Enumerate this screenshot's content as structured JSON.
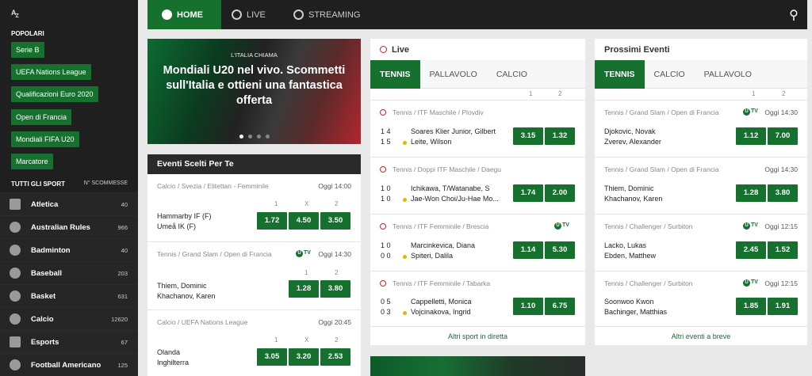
{
  "sidebar": {
    "az_a": "A",
    "az_z": "Z",
    "popular_heading": "POPOLARI",
    "popular": [
      "Serie B",
      "UEFA Nations League",
      "Qualificazioni Euro 2020",
      "Open di Francia",
      "Mondiali FIFA U20",
      "Marcatore"
    ],
    "all_sports": "TUTTI GLI SPORT",
    "num_bets": "N° SCOMMESSE",
    "sports": [
      {
        "name": "Atletica",
        "count": "40",
        "icon": "athletics-icon"
      },
      {
        "name": "Australian Rules",
        "count": "966",
        "icon": "aussie-rules-icon"
      },
      {
        "name": "Badminton",
        "count": "40",
        "icon": "badminton-icon"
      },
      {
        "name": "Baseball",
        "count": "203",
        "icon": "baseball-icon"
      },
      {
        "name": "Basket",
        "count": "631",
        "icon": "basketball-icon"
      },
      {
        "name": "Calcio",
        "count": "12620",
        "icon": "soccer-icon"
      },
      {
        "name": "Esports",
        "count": "67",
        "icon": "gamepad-icon"
      },
      {
        "name": "Football Americano",
        "count": "125",
        "icon": "american-football-icon"
      }
    ]
  },
  "nav": {
    "home": "HOME",
    "live": "LIVE",
    "streaming": "STREAMING"
  },
  "hero": {
    "kicker": "L'ITALIA CHIAMA",
    "headline": "Mondiali U20 nel vivo. Scommetti sull'Italia e ottieni una fantastica offerta"
  },
  "featured": {
    "title": "Eventi Scelti Per Te",
    "events": [
      {
        "cat": "Calcio / Svezia / Elitettan - Femminile",
        "time": "Oggi 14:00",
        "t1": "Hammarby IF (F)",
        "t2": "Umeå IK (F)",
        "labels": [
          "1",
          "X",
          "2"
        ],
        "odds": [
          "1.72",
          "4.50",
          "3.50"
        ]
      },
      {
        "cat": "Tennis / Grand Slam / Open di Francia",
        "time": "Oggi 14:30",
        "tv": "TV",
        "t1": "Thiem, Dominic",
        "t2": "Khachanov, Karen",
        "labels": [
          "1",
          "2"
        ],
        "odds": [
          "1.28",
          "3.80"
        ]
      },
      {
        "cat": "Calcio / UEFA Nations League",
        "time": "Oggi 20:45",
        "t1": "Olanda",
        "t2": "Inghilterra",
        "labels": [
          "1",
          "X",
          "2"
        ],
        "odds": [
          "3.05",
          "3.20",
          "2.53"
        ]
      }
    ]
  },
  "live": {
    "title": "Live",
    "tabs": [
      "TENNIS",
      "PALLAVOLO",
      "CALCIO"
    ],
    "col1": "1",
    "col2": "2",
    "events": [
      {
        "cat": "Tennis / ITF Maschile / Plovdiv",
        "s1": "1 4",
        "s2": "1 5",
        "t1": "Soares Klier Junior, Gilbert",
        "t2": "Leite, Wilson",
        "odds": [
          "3.15",
          "1.32"
        ]
      },
      {
        "cat": "Tennis / Doppi ITF Maschile / Daegu",
        "s1": "1 0",
        "s2": "1 0",
        "t1": "Ichikawa, T/Watanabe, S",
        "t2": "Jae-Won Choi/Ju-Hae Mo...",
        "odds": [
          "1.74",
          "2.00"
        ]
      },
      {
        "cat": "Tennis / ITF Femminile / Brescia",
        "tv": "TV",
        "s1": "1 0",
        "s2": "0 0",
        "t1": "Marcinkevica, Diana",
        "t2": "Spiteri, Dalila",
        "odds": [
          "1.14",
          "5.30"
        ]
      },
      {
        "cat": "Tennis / ITF Femminile / Tabarka",
        "s1": "0 5",
        "s2": "0 3",
        "t1": "Cappelletti, Monica",
        "t2": "Vojcinakova, Ingrid",
        "odds": [
          "1.10",
          "6.75"
        ]
      }
    ],
    "footer": "Altri sport in diretta"
  },
  "upcoming": {
    "title": "Prossimi Eventi",
    "tabs": [
      "TENNIS",
      "CALCIO",
      "PALLAVOLO"
    ],
    "col1": "1",
    "col2": "2",
    "events": [
      {
        "cat": "Tennis / Grand Slam / Open di Francia",
        "tv": "TV",
        "time": "Oggi 14:30",
        "t1": "Djokovic, Novak",
        "t2": "Zverev, Alexander",
        "odds": [
          "1.12",
          "7.00"
        ]
      },
      {
        "cat": "Tennis / Grand Slam / Open di Francia",
        "time": "Oggi 14:30",
        "t1": "Thiem, Dominic",
        "t2": "Khachanov, Karen",
        "odds": [
          "1.28",
          "3.80"
        ]
      },
      {
        "cat": "Tennis / Challenger / Surbiton",
        "tv": "TV",
        "time": "Oggi 12:15",
        "t1": "Lacko, Lukas",
        "t2": "Ebden, Matthew",
        "odds": [
          "2.45",
          "1.52"
        ]
      },
      {
        "cat": "Tennis / Challenger / Surbiton",
        "tv": "TV",
        "time": "Oggi 12:15",
        "t1": "Soonwoo Kwon",
        "t2": "Bachinger, Matthias",
        "odds": [
          "1.85",
          "1.91"
        ]
      }
    ],
    "footer": "Altri eventi a breve"
  },
  "colors": {
    "brand_green": "#16702e",
    "dark": "#1f1f1f",
    "live_red": "#cc2222",
    "serve_yellow": "#e0b800"
  }
}
